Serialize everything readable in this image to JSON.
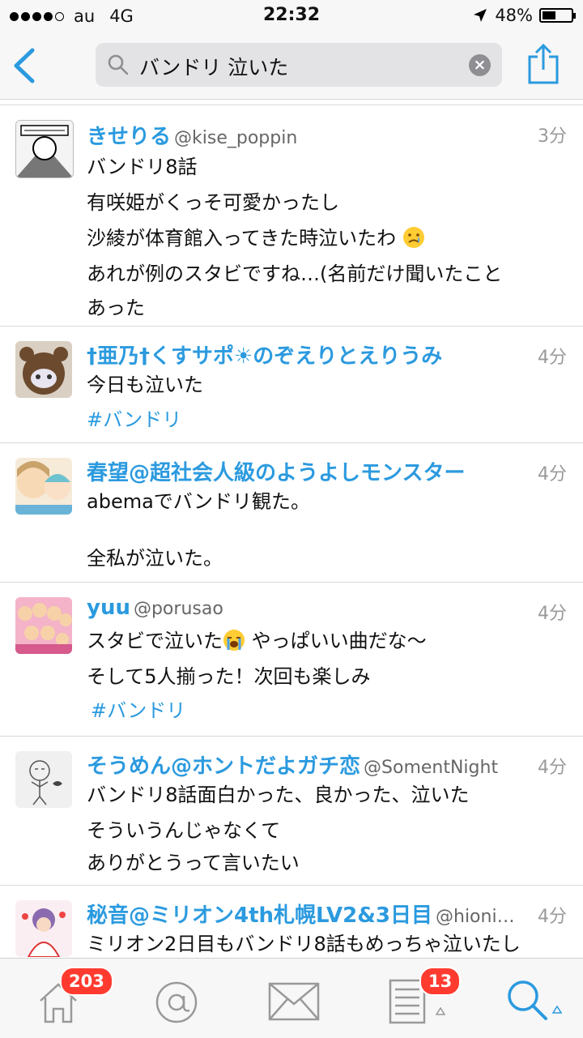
{
  "status_bar": {
    "carrier": "au",
    "network": "4G",
    "time": "22:32",
    "battery": "48%",
    "battery_level": 0.48
  },
  "nav": {
    "search_query": "バンドリ 泣いた"
  },
  "tweets": [
    {
      "name": "きせりる",
      "handle": "@kise_poppin",
      "time": "3分",
      "lines": [
        "バンドリ8話",
        "有咲姫がくっそ可愛かったし",
        "沙綾が体育館入ってきた時泣いたわ",
        "あれが例のスタビですね…(名前だけ聞いたこと",
        "あった"
      ]
    },
    {
      "name": "†亜乃†くすサポ☀のぞえりとえりうみ",
      "handle": "",
      "time": "4分",
      "lines": [
        "今日も泣いた"
      ],
      "hashtag": "#バンドリ"
    },
    {
      "name": "春望@超社会人級のようよしモンスター",
      "handle": "",
      "time": "4分",
      "lines": [
        "abemaでバンドリ観た。",
        "全私が泣いた。"
      ]
    },
    {
      "name": "yuu",
      "handle": "@porusao",
      "time": "4分",
      "lines": [
        "スタビで泣いた",
        "やっぱいい曲だな〜",
        "そして5人揃った！次回も楽しみ"
      ],
      "hashtag": "#バンドリ"
    },
    {
      "name": "そうめん@ホントだよガチ恋",
      "handle": "@SomentNight",
      "time": "4分",
      "lines": [
        "バンドリ8話面白かった、良かった、泣いた",
        "そういうんじゃなくて",
        "ありがとうって言いたい"
      ]
    },
    {
      "name": "秘音@ミリオン4th札幌LV2&3日目",
      "handle": "@hioni…",
      "time": "4分",
      "lines": [
        "ミリオン2日目もバンドリ8話もめっちゃ泣いたし"
      ]
    }
  ],
  "tab_bar": {
    "home_badge": "203",
    "lists_badge": "13",
    "accent_color": "#2b9adf",
    "icons": [
      "home-icon",
      "at-icon",
      "mail-icon",
      "list-icon",
      "search-icon"
    ]
  }
}
